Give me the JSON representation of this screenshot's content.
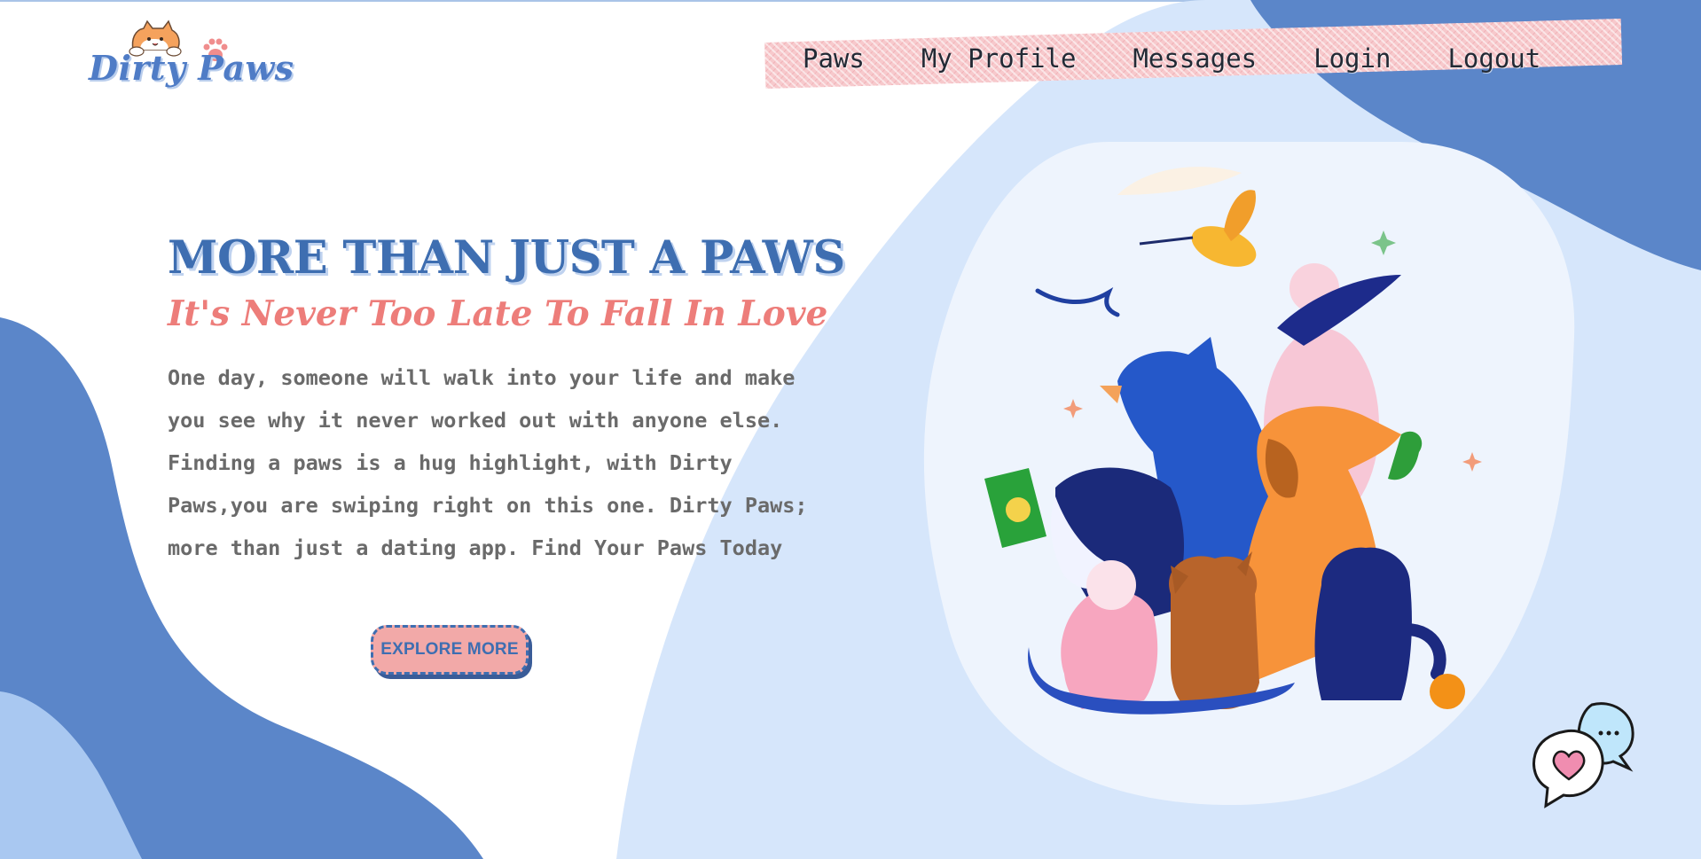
{
  "app": {
    "name": "Dirty Paws"
  },
  "nav": {
    "items": [
      {
        "label": "Paws"
      },
      {
        "label": "My Profile"
      },
      {
        "label": "Messages"
      },
      {
        "label": "Login"
      },
      {
        "label": "Logout"
      }
    ]
  },
  "hero": {
    "title": "MORE THAN JUST A PAWS",
    "subtitle": "It's Never Too Late To Fall In Love",
    "body": "One day, someone will walk into your life and make you see why it never worked out with anyone else. Finding a paws is a hug highlight, with Dirty Paws,you are swiping right on this one. Dirty Paws; more than just a dating app. Find Your Paws Today",
    "cta_label": "EXPLORE MORE"
  },
  "icons": {
    "logo_mascot": "cat-face-icon",
    "logo_paw": "paw-print-icon",
    "chat": "chat-bubbles-heart-icon"
  },
  "colors": {
    "brand_blue": "#3e6eb1",
    "accent_pink": "#ed7d7a",
    "button_pink": "#f2a9a8",
    "blob_dark": "#5b86c9",
    "blob_light": "#d6e6fb"
  }
}
